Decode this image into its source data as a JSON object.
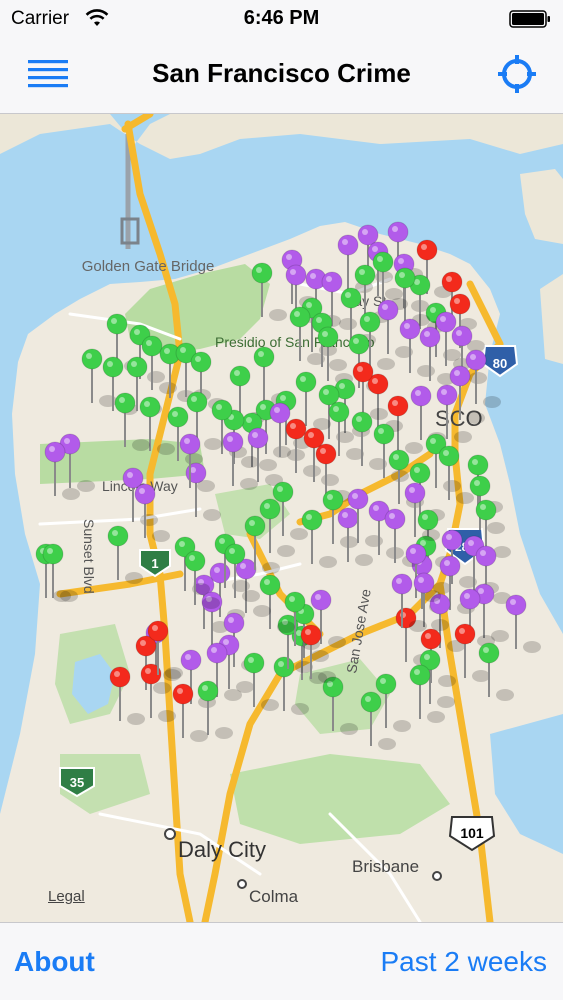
{
  "status_bar": {
    "carrier": "Carrier",
    "time": "6:46 PM",
    "wifi_icon": "wifi-icon",
    "battery_icon": "battery-icon"
  },
  "nav_bar": {
    "title": "San Francisco Crime",
    "menu_icon": "hamburger-menu-icon",
    "locate_icon": "location-crosshair-icon",
    "accent_color": "#1a7cf5"
  },
  "map": {
    "labels": {
      "golden_gate": "Golden Gate Bridge",
      "presidio": "Presidio of San Francisco",
      "bay_st": "Bay St",
      "lincoln_way": "Lincoln Way",
      "sunset_blvd": "Sunset Blvd",
      "san_jose_ave": "San Jose Ave",
      "daly_city": "Daly City",
      "brisbane": "Brisbane",
      "colma": "Colma",
      "sf": "SCO",
      "hwy_1": "1",
      "hwy_80": "80",
      "hwy_280": "280",
      "hwy_35": "35",
      "hwy_101": "101",
      "legal": "Legal"
    },
    "pin_colors": {
      "green": "#3ecf4a",
      "purple": "#b25bea",
      "red": "#f32a1c"
    }
  },
  "toolbar": {
    "about_label": "About",
    "range_label": "Past 2 weeks"
  }
}
